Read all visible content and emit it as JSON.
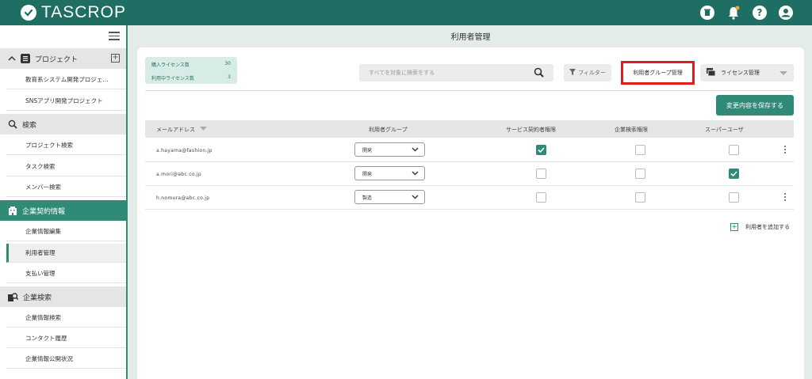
{
  "app": {
    "logo_text": "TASCROP"
  },
  "header_icons": [
    "trash-icon",
    "bell-icon",
    "help-icon",
    "user-icon"
  ],
  "sidebar": {
    "project_label": "プロジェクト",
    "projects": [
      "教育系システム開発プロジェ…",
      "SNSアプリ開発プロジェクト"
    ],
    "search_label": "検索",
    "search_items": [
      "プロジェクト検索",
      "タスク検索",
      "メンバー検索"
    ],
    "contract_label": "企業契約情報",
    "contract_items": [
      "企業情報編集",
      "利用者管理",
      "支払い管理"
    ],
    "company_search_label": "企業検索",
    "company_items": [
      "企業情報検索",
      "コンタクト履歴",
      "企業情報公開状況"
    ]
  },
  "page": {
    "title": "利用者管理"
  },
  "license": {
    "purchased_label": "購入ライセンス数",
    "purchased_value": "30",
    "used_label": "利用中ライセンス数",
    "used_value": "3"
  },
  "toolbar": {
    "search_placeholder": "すべてを対象に検索をする",
    "filter_label": "フィルター",
    "group_manage_label": "利用者グループ管理",
    "license_manage_label": "ライセンス管理",
    "save_label": "変更内容を保存する"
  },
  "table": {
    "headers": [
      "メールアドレス",
      "利用者グループ",
      "サービス契約者権限",
      "企業検索権限",
      "スーパーユーザ"
    ],
    "rows": [
      {
        "email": "a.hayama@fashion.jp",
        "group": "開発",
        "service": true,
        "company": false,
        "super": false,
        "menu": true
      },
      {
        "email": "a.mori@abc.co.jp",
        "group": "開発",
        "service": false,
        "company": false,
        "super": true,
        "menu": false
      },
      {
        "email": "h.nomura@abc.co.jp",
        "group": "製造",
        "service": false,
        "company": false,
        "super": false,
        "menu": true
      }
    ]
  },
  "add_user_label": "利用者を追加する",
  "colors": {
    "brand": "#1f6e63",
    "accent": "#2f8a78",
    "highlight_border": "#e01c1c"
  }
}
